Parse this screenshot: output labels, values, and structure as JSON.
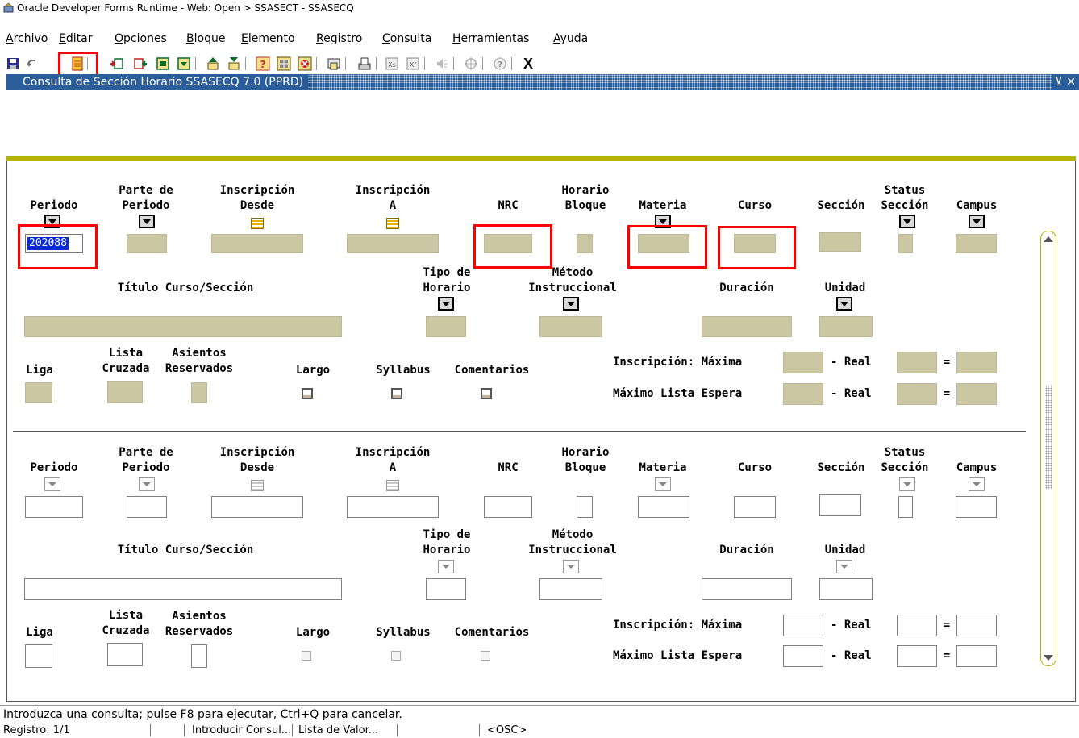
{
  "window": {
    "title": "Oracle Developer Forms Runtime - Web:  Open > SSASECT - SSASECQ"
  },
  "menu": [
    {
      "label": "Archivo",
      "u": "A",
      "rest": "rchivo"
    },
    {
      "label": "Editar",
      "u": "E",
      "rest": "ditar"
    },
    {
      "label": "Opciones",
      "u": "O",
      "rest": "pciones"
    },
    {
      "label": "Bloque",
      "u": "B",
      "rest": "loque"
    },
    {
      "label": "Elemento",
      "u": "E",
      "rest": "lemento"
    },
    {
      "label": "Registro",
      "u": "R",
      "rest": "egistro"
    },
    {
      "label": "Consulta",
      "u": "C",
      "rest": "onsulta"
    },
    {
      "label": "Herramientas",
      "u": "H",
      "rest": "erramientas"
    },
    {
      "label": "Ayuda",
      "u": "A",
      "rest": "yuda"
    }
  ],
  "toolbar": {
    "icons": [
      "save-icon",
      "rollback-icon",
      "enter-query-icon",
      "insert-record-icon",
      "remove-record-icon",
      "previous-block-icon",
      "next-block-icon",
      "export-icon",
      "save-query-icon",
      "help-icon",
      "options-icon",
      "cancel-icon",
      "print-icon",
      "print-preview-icon",
      "calculator-icon",
      "calculator2-icon",
      "audio-icon",
      "target-icon",
      "info-icon",
      "exit-icon"
    ],
    "exit_label": "X"
  },
  "form": {
    "title": "Consulta de Sección Horario  SSASECQ  7.0  (PPRD)",
    "controls": "⊻ ✕",
    "labels": {
      "periodo": "Periodo",
      "parte_de": "Parte de",
      "parte_periodo": "Periodo",
      "inscripcion": "Inscripción",
      "desde": "Desde",
      "a": "A",
      "nrc": "NRC",
      "horario": "Horario",
      "bloque": "Bloque",
      "materia": "Materia",
      "curso": "Curso",
      "seccion": "Sección",
      "status": "Status",
      "status_seccion": "Sección",
      "campus": "Campus",
      "titulo": "Título Curso/Sección",
      "tipo_de": "Tipo de",
      "tipo_horario": "Horario",
      "metodo": "Método",
      "instruccional": "Instruccional",
      "duracion": "Duración",
      "unidad": "Unidad",
      "liga": "Liga",
      "lista": "Lista",
      "cruzada": "Cruzada",
      "asientos": "Asientos",
      "reservados": "Reservados",
      "largo": "Largo",
      "syllabus": "Syllabus",
      "comentarios": "Comentarios",
      "insc_maxima": "Inscripción: Máxima",
      "max_lista": "Máximo Lista Espera",
      "dash_real": "-  Real",
      "equals": "="
    },
    "periodo_value": "202088"
  },
  "status": {
    "message": "Introduzca una consulta;  pulse F8 para ejecutar, Ctrl+Q para cancelar.",
    "record": "Registro: 1/1",
    "mode": "Introducir Consul...",
    "lov": "Lista de Valor...",
    "osc": "<OSC>"
  },
  "colors": {
    "active_field": "#cbc7a2",
    "window_bar": "#2a5d9a",
    "accent_line": "#b4b400",
    "annotation": "#ff0000"
  }
}
